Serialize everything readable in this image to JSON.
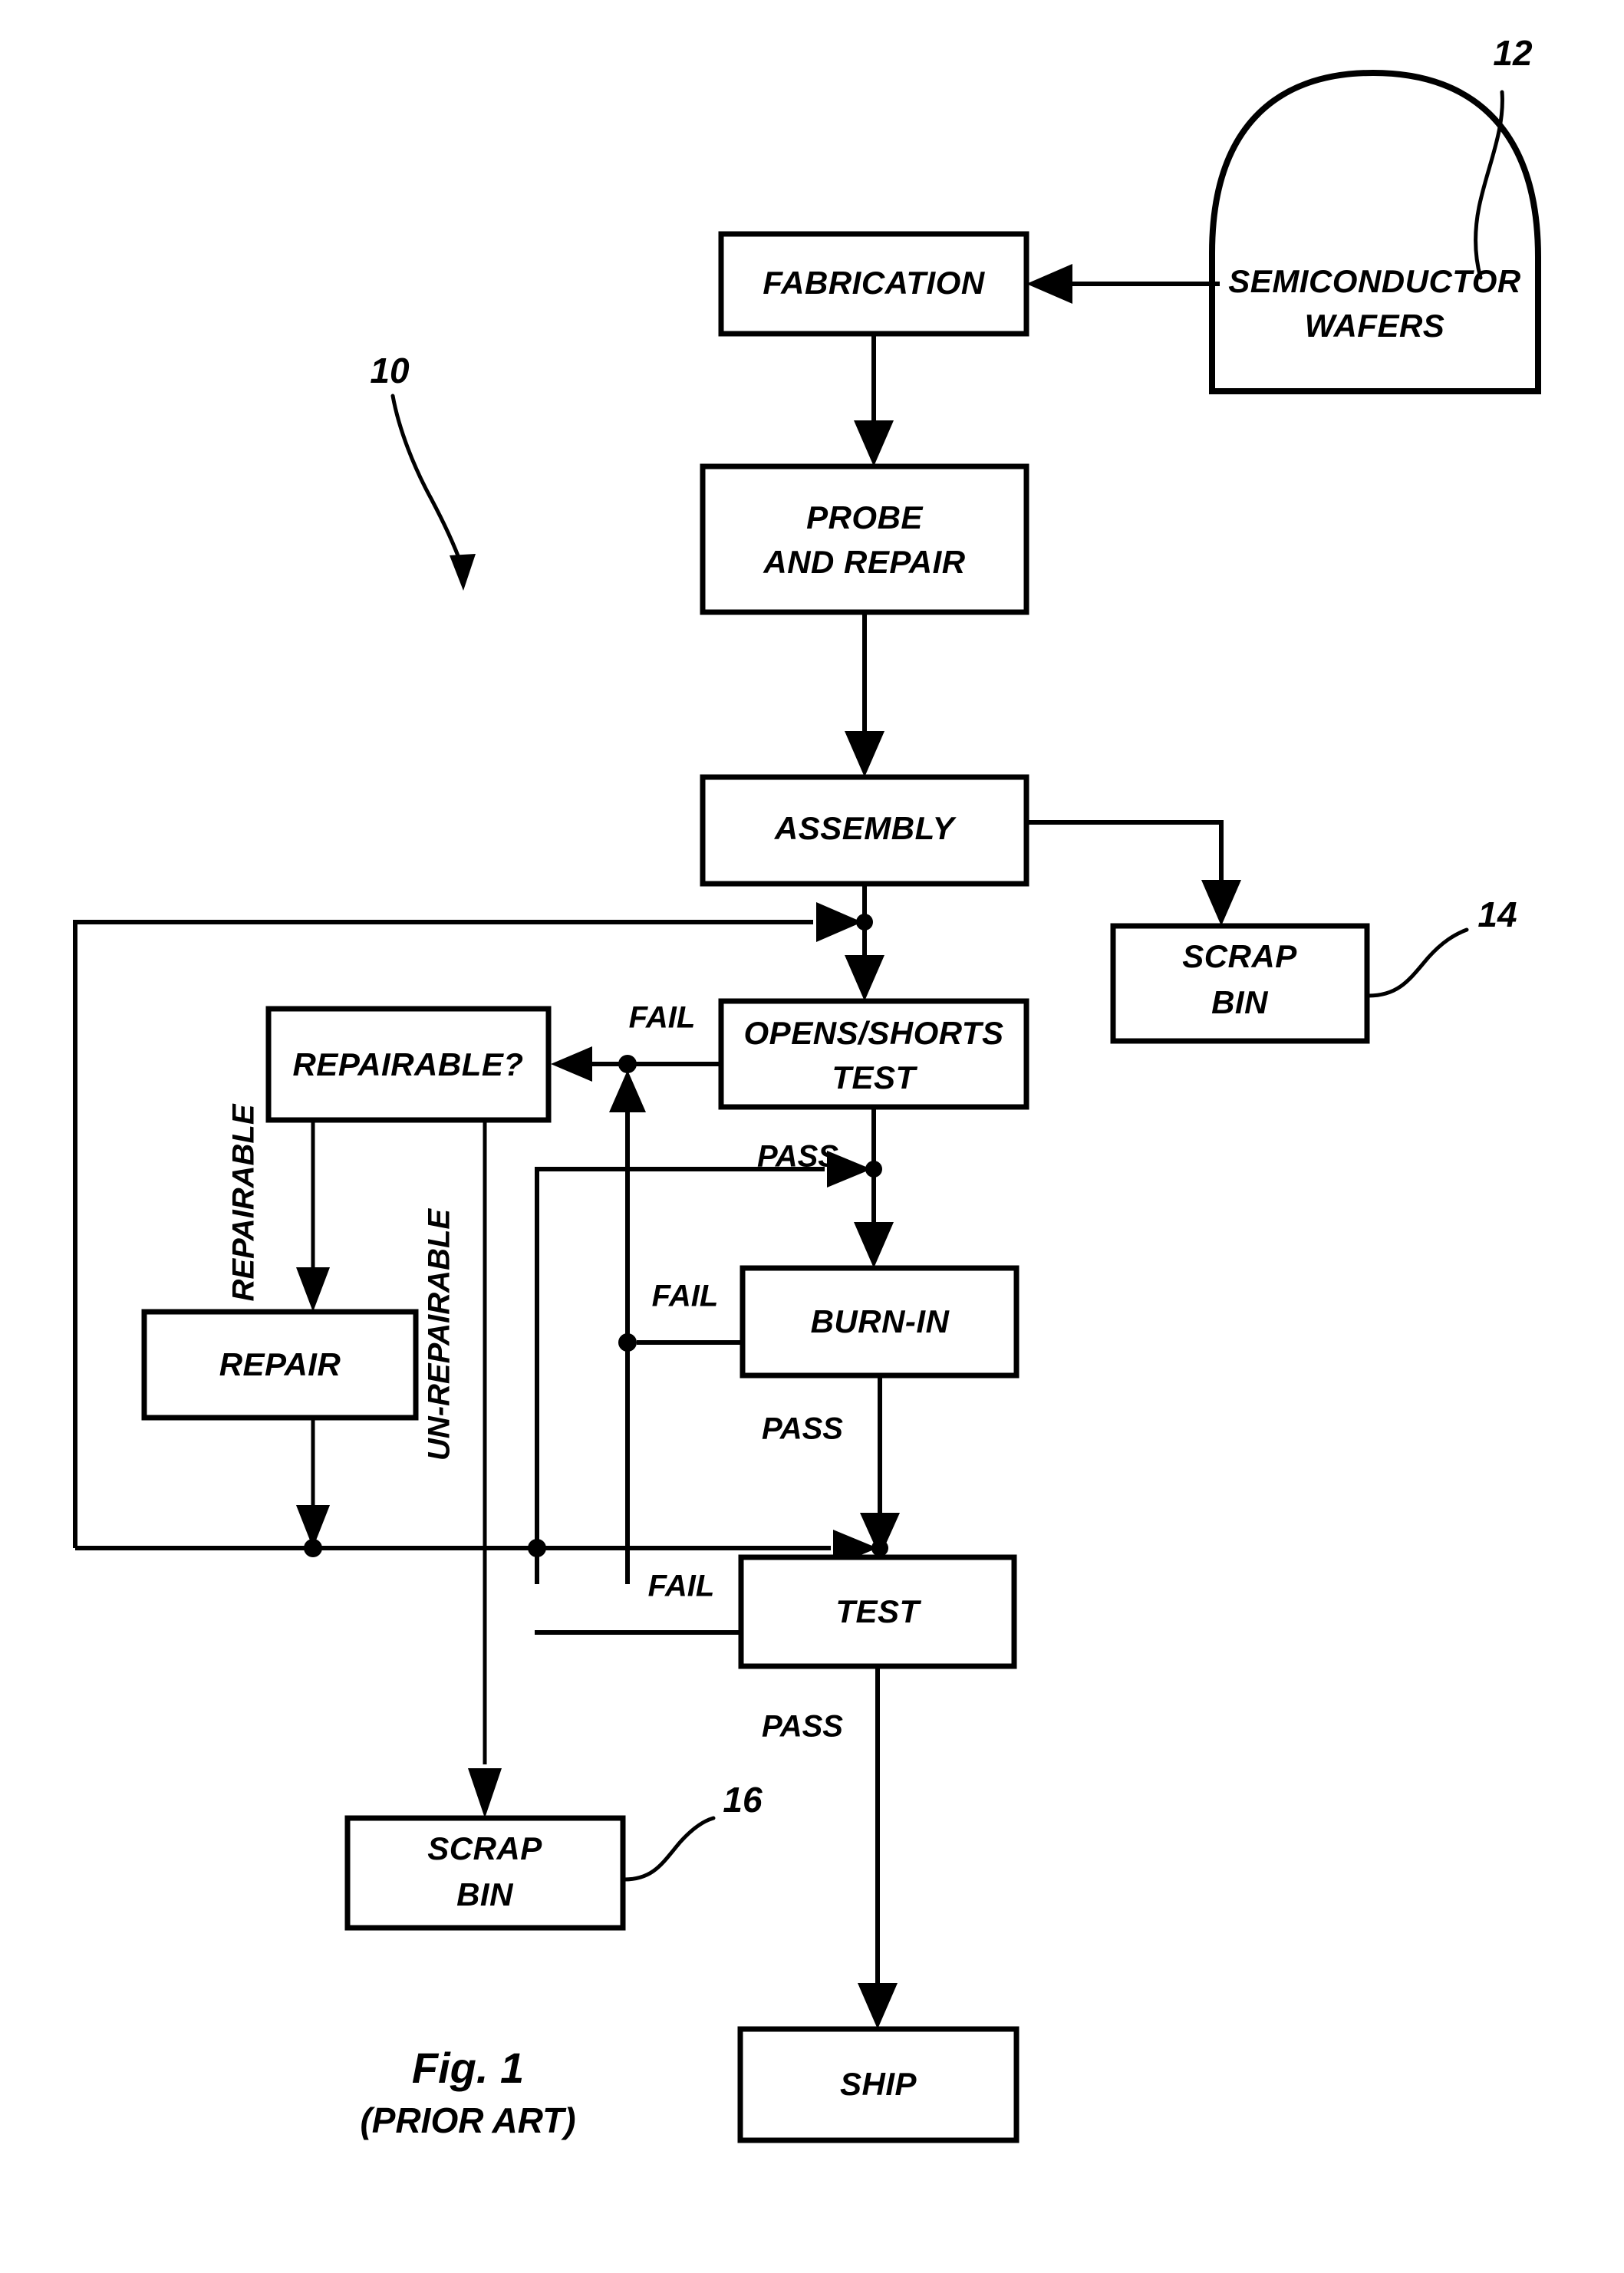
{
  "figure": {
    "caption": "Fig. 1",
    "subcaption": "(PRIOR ART)"
  },
  "reference_numerals": {
    "process": "10",
    "wafers": "12",
    "scrap_bin_assembly": "14",
    "scrap_bin_unrepairable": "16"
  },
  "nodes": {
    "wafers": "SEMICONDUCTOR\nWAFERS",
    "wafers_line1": "SEMICONDUCTOR",
    "wafers_line2": "WAFERS",
    "fabrication": "FABRICATION",
    "probe_line1": "PROBE",
    "probe_line2": "AND REPAIR",
    "assembly": "ASSEMBLY",
    "scrap_bin_14_line1": "SCRAP",
    "scrap_bin_14_line2": "BIN",
    "opens_shorts_line1": "OPENS/SHORTS",
    "opens_shorts_line2": "TEST",
    "repairable": "REPAIRABLE?",
    "repair": "REPAIR",
    "burn_in": "BURN-IN",
    "test": "TEST",
    "scrap_bin_16_line1": "SCRAP",
    "scrap_bin_16_line2": "BIN",
    "ship": "SHIP"
  },
  "edge_labels": {
    "opens_shorts_fail": "FAIL",
    "opens_shorts_pass": "PASS",
    "burn_in_fail": "FAIL",
    "burn_in_pass": "PASS",
    "test_fail": "FAIL",
    "test_pass": "PASS",
    "repairable_yes": "REPAIRABLE",
    "repairable_no": "UN-REPAIRABLE"
  },
  "style": {
    "ink": "#000000",
    "paper": "#ffffff"
  },
  "chart_data": {
    "type": "diagram",
    "title": "Fig. 1 (PRIOR ART)",
    "diagram_kind": "process-flowchart",
    "nodes": [
      {
        "id": "wafers",
        "label": "SEMICONDUCTOR WAFERS",
        "shape": "wafer-stack",
        "ref": "12"
      },
      {
        "id": "fabrication",
        "label": "FABRICATION",
        "shape": "rect"
      },
      {
        "id": "probe",
        "label": "PROBE AND REPAIR",
        "shape": "rect"
      },
      {
        "id": "assembly",
        "label": "ASSEMBLY",
        "shape": "rect"
      },
      {
        "id": "scrap14",
        "label": "SCRAP BIN",
        "shape": "rect",
        "ref": "14"
      },
      {
        "id": "opens",
        "label": "OPENS/SHORTS TEST",
        "shape": "rect"
      },
      {
        "id": "repairable",
        "label": "REPAIRABLE?",
        "shape": "rect"
      },
      {
        "id": "repair",
        "label": "REPAIR",
        "shape": "rect"
      },
      {
        "id": "burnin",
        "label": "BURN-IN",
        "shape": "rect"
      },
      {
        "id": "test",
        "label": "TEST",
        "shape": "rect"
      },
      {
        "id": "scrap16",
        "label": "SCRAP BIN",
        "shape": "rect",
        "ref": "16"
      },
      {
        "id": "ship",
        "label": "SHIP",
        "shape": "rect"
      }
    ],
    "edges": [
      {
        "from": "wafers",
        "to": "fabrication",
        "label": ""
      },
      {
        "from": "fabrication",
        "to": "probe",
        "label": ""
      },
      {
        "from": "probe",
        "to": "assembly",
        "label": ""
      },
      {
        "from": "assembly",
        "to": "scrap14",
        "label": ""
      },
      {
        "from": "assembly",
        "to": "opens",
        "label": ""
      },
      {
        "from": "opens",
        "to": "repairable",
        "label": "FAIL"
      },
      {
        "from": "opens",
        "to": "burnin",
        "label": "PASS"
      },
      {
        "from": "repairable",
        "to": "repair",
        "label": "REPAIRABLE"
      },
      {
        "from": "repairable",
        "to": "scrap16",
        "label": "UN-REPAIRABLE"
      },
      {
        "from": "repair",
        "to": "opens",
        "label": ""
      },
      {
        "from": "burnin",
        "to": "repairable",
        "label": "FAIL"
      },
      {
        "from": "burnin",
        "to": "test",
        "label": "PASS"
      },
      {
        "from": "test",
        "to": "repairable",
        "label": "FAIL"
      },
      {
        "from": "test",
        "to": "ship",
        "label": "PASS"
      }
    ]
  }
}
